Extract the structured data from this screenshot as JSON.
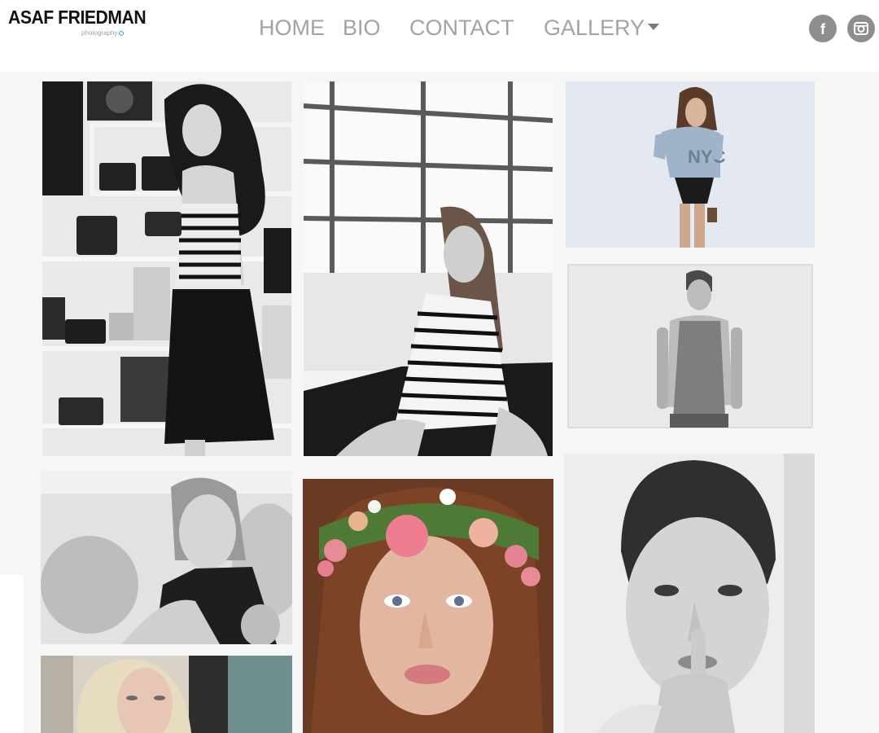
{
  "header": {
    "logo_text": "ASAF FRIEDMAN",
    "logo_subtext": "photography",
    "nav": [
      {
        "label": "HOME"
      },
      {
        "label": "BIO"
      },
      {
        "label": "CONTACT"
      },
      {
        "label": "GALLERY",
        "has_dropdown": true
      }
    ],
    "social": [
      {
        "icon": "facebook-icon",
        "glyph": "f"
      },
      {
        "icon": "instagram-icon",
        "glyph": "camera"
      }
    ]
  },
  "gallery": {
    "photos": [
      {
        "subject": "woman-with-vintage-cameras",
        "style": "black-and-white"
      },
      {
        "subject": "woman-in-striped-dress-by-window",
        "style": "black-and-white"
      },
      {
        "subject": "woman-in-nyc-tshirt",
        "style": "color"
      },
      {
        "subject": "man-in-tank-top",
        "style": "black-and-white"
      },
      {
        "subject": "woman-portrait-soft",
        "style": "black-and-white"
      },
      {
        "subject": "woman-with-flower-crown",
        "style": "color"
      },
      {
        "subject": "woman-finger-on-lips",
        "style": "black-and-white"
      },
      {
        "subject": "blonde-woman-portrait",
        "style": "color"
      }
    ]
  },
  "colors": {
    "nav_text": "#a3a3a3",
    "social_bg": "#8e8e8e",
    "gallery_bg": "#f6f6f6",
    "logo_text": "#111111"
  }
}
